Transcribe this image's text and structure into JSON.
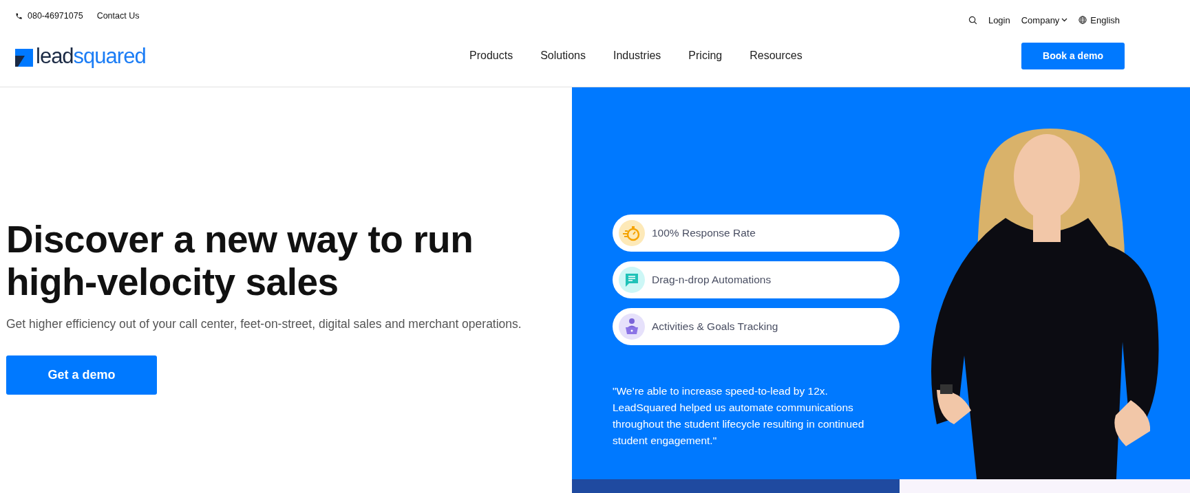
{
  "topbar": {
    "phone": "080-46971075",
    "contact": "Contact Us",
    "login": "Login",
    "company": "Company",
    "language": "English"
  },
  "logo": {
    "part1": "lead",
    "part2": "squared"
  },
  "nav": [
    "Products",
    "Solutions",
    "Industries",
    "Pricing",
    "Resources"
  ],
  "header_button": "Book a demo",
  "hero": {
    "title": "Discover a new way to run high-velocity sales",
    "subtitle": "Get higher efficiency out of your call center, feet-on-street, digital sales and merchant operations.",
    "button": "Get a demo"
  },
  "features": [
    {
      "kind": "stopwatch",
      "label": "100% Response Rate"
    },
    {
      "kind": "chat",
      "label": "Drag-n-drop Automations"
    },
    {
      "kind": "person",
      "label": "Activities & Goals Tracking"
    }
  ],
  "quote": "\"We’re able to increase speed-to-lead by 12x. LeadSquared helped us automate communications throughout the student lifecycle resulting in continued student engagement.\""
}
